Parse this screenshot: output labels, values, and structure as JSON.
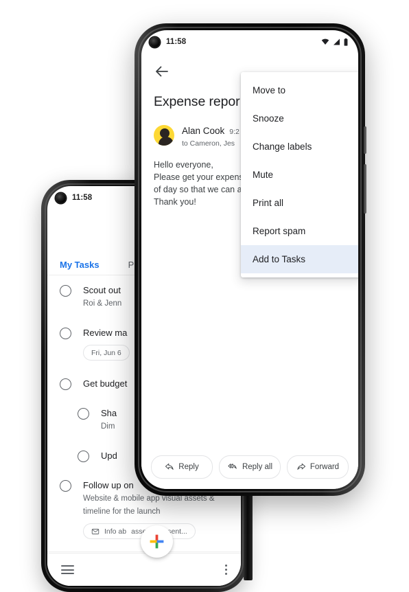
{
  "scene": {
    "description": "Two Android phones: front phone shows Gmail message with overflow menu open; back phone shows Google Tasks list"
  },
  "mail_phone": {
    "status_bar": {
      "time": "11:58",
      "icons": [
        "wifi-icon",
        "cellular-signal-icon",
        "battery-icon"
      ]
    },
    "back_icon": "back-arrow-icon",
    "subject": "Expense repor",
    "sender": {
      "avatar": "person-avatar",
      "name": "Alan Cook",
      "time": "9:2",
      "recipients": "to Cameron, Jes"
    },
    "body_lines": [
      "Hello everyone,",
      "Please get your expens",
      "of day so that we can a",
      "Thank you!"
    ],
    "overflow_menu": {
      "items": [
        {
          "label": "Move to",
          "selected": false
        },
        {
          "label": "Snooze",
          "selected": false
        },
        {
          "label": "Change labels",
          "selected": false
        },
        {
          "label": "Mute",
          "selected": false
        },
        {
          "label": "Print all",
          "selected": false
        },
        {
          "label": "Report spam",
          "selected": false
        },
        {
          "label": "Add to Tasks",
          "selected": true
        }
      ],
      "highlight_color": "#e6edf8"
    },
    "reply_bar": [
      {
        "label": "Reply",
        "icon": "reply-icon"
      },
      {
        "label": "Reply all",
        "icon": "reply-all-icon"
      },
      {
        "label": "Forward",
        "icon": "forward-icon"
      }
    ]
  },
  "tasks_phone": {
    "status_bar": {
      "time": "11:58"
    },
    "tabs": [
      {
        "label": "My Tasks",
        "active": true
      },
      {
        "label": "Projec",
        "active": false
      }
    ],
    "tasks": [
      {
        "title": "Scout out",
        "subtitle": "Roi & Jenn",
        "chip": null,
        "sub": false
      },
      {
        "title": "Review ma",
        "subtitle": null,
        "chip": {
          "label": "Fri, Jun 6",
          "icon": null
        },
        "sub": false
      },
      {
        "title": "Get budget",
        "subtitle": null,
        "chip": null,
        "sub": false
      },
      {
        "title": "Sha",
        "subtitle": "Dim",
        "chip": null,
        "sub": true
      },
      {
        "title": "Upd",
        "subtitle": null,
        "chip": null,
        "sub": true
      },
      {
        "title": "Follow up on",
        "subtitle": "Website & mobile app visual assets &",
        "subtitle2": "timeline for the launch",
        "chip": {
          "label": "Info ab",
          "label2": "assets you sent...",
          "icon": "envelope-icon"
        },
        "sub": false
      }
    ],
    "bottom_bar": {
      "menu_icon": "hamburger-menu-icon",
      "more_icon": "kebab-more-icon"
    }
  },
  "fab": {
    "icon": "google-plus-add-icon",
    "colors": {
      "blue": "#4285f4",
      "red": "#ea4335",
      "yellow": "#fbbc05",
      "green": "#34a853"
    }
  }
}
